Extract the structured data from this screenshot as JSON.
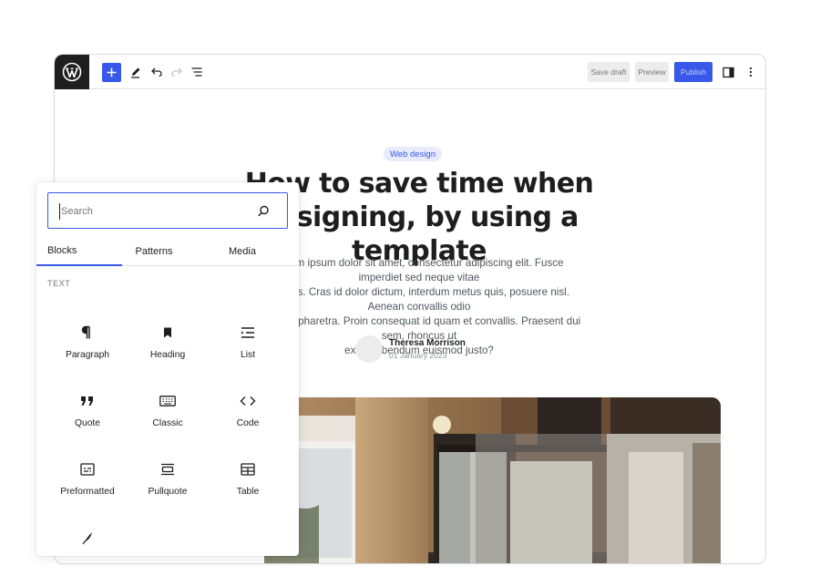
{
  "toolbar": {
    "save_draft": "Save draft",
    "preview": "Preview",
    "publish": "Publish"
  },
  "post": {
    "category": "Web design",
    "title_line1": "How to save time when",
    "title_line2": "designing, by using a template",
    "excerpt_line1": "Lorem ipsum dolor sit amet, consectetur adipiscing elit. Fusce imperdiet sed neque vitae",
    "excerpt_line2": "facilisis. Cras id dolor dictum, interdum metus quis, posuere nisl. Aenean convallis odio",
    "excerpt_line3": "in quam pharetra. Proin consequat id quam et convallis. Praesent dui sem, rhoncus ut",
    "excerpt_line4": "ex ut, bibendum euismod justo?",
    "author_name": "Theresa Morrison",
    "author_date": "01 January 2023"
  },
  "inserter": {
    "search_placeholder": "Search",
    "tabs": [
      "Blocks",
      "Patterns",
      "Media"
    ],
    "section": "TEXT",
    "blocks": [
      {
        "label": "Paragraph",
        "icon": "paragraph-icon"
      },
      {
        "label": "Heading",
        "icon": "heading-icon"
      },
      {
        "label": "List",
        "icon": "list-icon"
      },
      {
        "label": "Quote",
        "icon": "quote-icon"
      },
      {
        "label": "Classic",
        "icon": "classic-icon"
      },
      {
        "label": "Code",
        "icon": "code-icon"
      },
      {
        "label": "Preformatted",
        "icon": "preformatted-icon"
      },
      {
        "label": "Pullquote",
        "icon": "pullquote-icon"
      },
      {
        "label": "Table",
        "icon": "table-icon"
      },
      {
        "label": "",
        "icon": "verse-icon"
      }
    ]
  },
  "colors": {
    "accent": "#3858e9",
    "dark": "#1e1e1e"
  }
}
